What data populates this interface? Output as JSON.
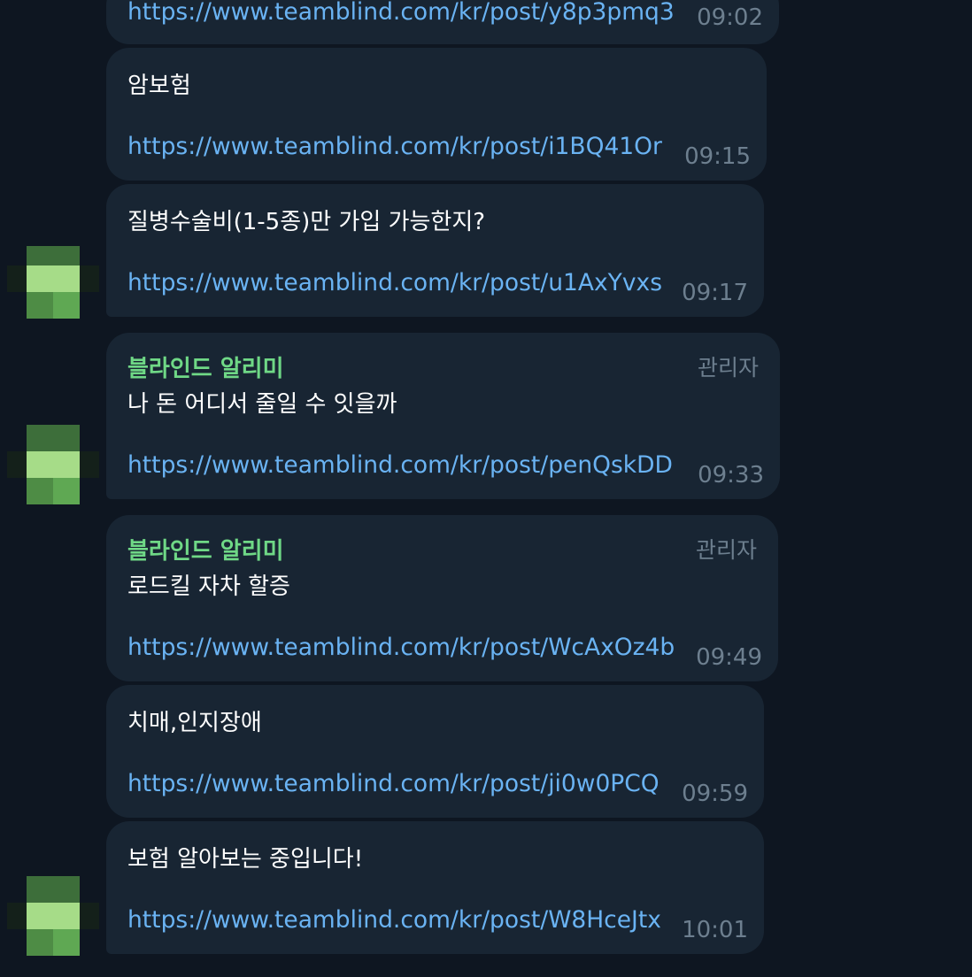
{
  "messages": [
    {
      "text": "",
      "link": "https://www.teamblind.com/kr/post/y8p3pmq3",
      "time": "09:02"
    },
    {
      "text": "암보험",
      "link": "https://www.teamblind.com/kr/post/i1BQ41Or",
      "time": "09:15"
    },
    {
      "text": "질병수술비(1-5종)만 가입 가능한지?",
      "link": "https://www.teamblind.com/kr/post/u1AxYvxs",
      "time": "09:17"
    },
    {
      "sender": "블라인드 알리미",
      "badge": "관리자",
      "text": "나 돈 어디서 줄일 수 잇을까",
      "link": "https://www.teamblind.com/kr/post/penQskDD",
      "time": "09:33"
    },
    {
      "sender": "블라인드 알리미",
      "badge": "관리자",
      "text": "로드킬 자차 할증",
      "link": "https://www.teamblind.com/kr/post/WcAxOz4b",
      "time": "09:49"
    },
    {
      "text": "치매,인지장애",
      "link": "https://www.teamblind.com/kr/post/ji0w0PCQ",
      "time": "09:59"
    },
    {
      "text": "보험 알아보는 중입니다!",
      "link": "https://www.teamblind.com/kr/post/W8HceJtx",
      "time": "10:01"
    }
  ],
  "colors": {
    "background": "#0e1621",
    "bubble": "#182533",
    "link": "#6ab3f3",
    "sender": "#6fd886",
    "meta": "#6d7f8f"
  }
}
